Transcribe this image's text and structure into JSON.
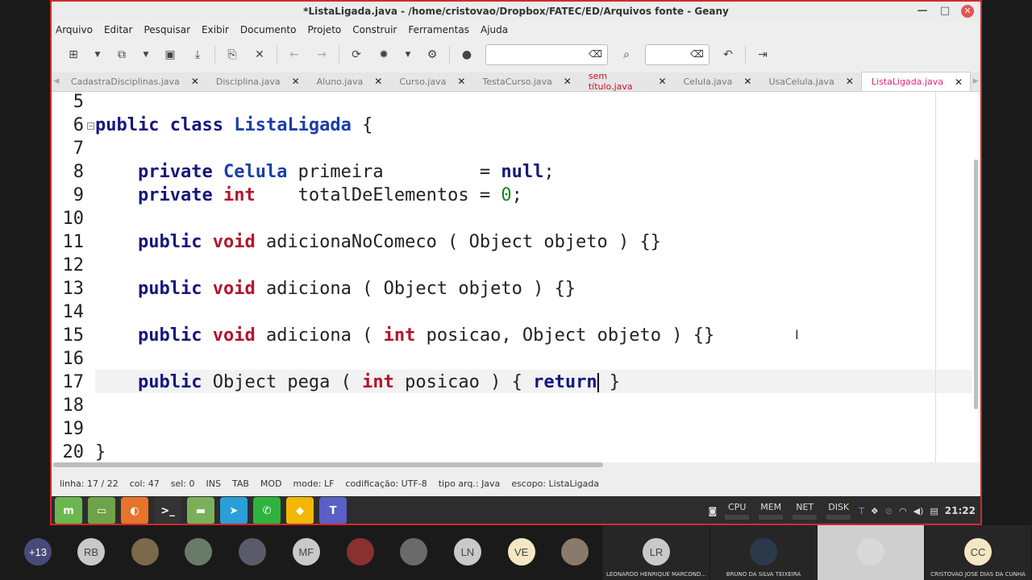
{
  "window": {
    "title": "*ListaLigada.java - /home/cristovao/Dropbox/FATEC/ED/Arquivos fonte - Geany"
  },
  "menu": [
    "Arquivo",
    "Editar",
    "Pesquisar",
    "Exibir",
    "Documento",
    "Projeto",
    "Construir",
    "Ferramentas",
    "Ajuda"
  ],
  "toolbar": {
    "icons": [
      "new-file-icon",
      "dropdown-icon",
      "open-file-icon",
      "dropdown-icon",
      "save-icon",
      "save-all-icon",
      "revert-icon",
      "close-file-icon",
      "back-icon",
      "forward-icon",
      "compile-icon",
      "build-icon",
      "dropdown-icon",
      "execute-icon",
      "color-picker-icon"
    ],
    "search_value": "",
    "goto_value": ""
  },
  "tabs": [
    {
      "label": "CadastraDisciplinas.java",
      "state": "normal"
    },
    {
      "label": "Disciplina.java",
      "state": "normal"
    },
    {
      "label": "Aluno.java",
      "state": "normal"
    },
    {
      "label": "Curso.java",
      "state": "normal"
    },
    {
      "label": "TestaCurso.java",
      "state": "normal"
    },
    {
      "label": "sem título.java",
      "state": "modified"
    },
    {
      "label": "Celula.java",
      "state": "normal"
    },
    {
      "label": "UsaCelula.java",
      "state": "normal"
    },
    {
      "label": "ListaLigada.java",
      "state": "active"
    }
  ],
  "editor": {
    "line_numbers": [
      "5",
      "6",
      "7",
      "8",
      "9",
      "10",
      "11",
      "12",
      "13",
      "14",
      "15",
      "16",
      "17",
      "18",
      "19",
      "20"
    ],
    "lines": [
      {
        "n": "6",
        "tokens": [
          {
            "t": "public",
            "c": "kw"
          },
          {
            "t": " "
          },
          {
            "t": "class",
            "c": "kw"
          },
          {
            "t": " "
          },
          {
            "t": "ListaLigada",
            "c": "cls"
          },
          {
            "t": " {"
          }
        ]
      },
      {
        "n": "8",
        "tokens": [
          {
            "t": "    "
          },
          {
            "t": "private",
            "c": "kw"
          },
          {
            "t": " "
          },
          {
            "t": "Celula",
            "c": "cls"
          },
          {
            "t": " primeira         = "
          },
          {
            "t": "null",
            "c": "kw"
          },
          {
            "t": ";"
          }
        ]
      },
      {
        "n": "9",
        "tokens": [
          {
            "t": "    "
          },
          {
            "t": "private",
            "c": "kw"
          },
          {
            "t": " "
          },
          {
            "t": "int",
            "c": "ty"
          },
          {
            "t": "    totalDeElementos = "
          },
          {
            "t": "0",
            "c": "num"
          },
          {
            "t": ";"
          }
        ]
      },
      {
        "n": "11",
        "tokens": [
          {
            "t": "    "
          },
          {
            "t": "public",
            "c": "kw"
          },
          {
            "t": " "
          },
          {
            "t": "void",
            "c": "ty"
          },
          {
            "t": " adicionaNoComeco ( Object objeto ) {}"
          }
        ]
      },
      {
        "n": "13",
        "tokens": [
          {
            "t": "    "
          },
          {
            "t": "public",
            "c": "kw"
          },
          {
            "t": " "
          },
          {
            "t": "void",
            "c": "ty"
          },
          {
            "t": " adiciona ( Object objeto ) {}"
          }
        ]
      },
      {
        "n": "15",
        "tokens": [
          {
            "t": "    "
          },
          {
            "t": "public",
            "c": "kw"
          },
          {
            "t": " "
          },
          {
            "t": "void",
            "c": "ty"
          },
          {
            "t": " adiciona ( "
          },
          {
            "t": "int",
            "c": "ty"
          },
          {
            "t": " posicao, Object objeto ) {}"
          }
        ]
      },
      {
        "n": "17",
        "tokens": [
          {
            "t": "    "
          },
          {
            "t": "public",
            "c": "kw"
          },
          {
            "t": " Object pega ( "
          },
          {
            "t": "int",
            "c": "ty"
          },
          {
            "t": " posicao ) { "
          },
          {
            "t": "return",
            "c": "kw"
          },
          {
            "t": "|CURSOR|"
          },
          {
            "t": " }"
          }
        ]
      },
      {
        "n": "20",
        "tokens": [
          {
            "t": "}"
          }
        ]
      }
    ]
  },
  "status": {
    "line": "linha: 17 / 22",
    "col": "col: 47",
    "sel": "sel: 0",
    "ins": "INS",
    "tab": "TAB",
    "mod": "MOD",
    "mode": "mode: LF",
    "encoding": "codificação: UTF-8",
    "filetype": "tipo arq.: Java",
    "scope": "escopo: ListaLigada"
  },
  "panel": {
    "apps": [
      {
        "name": "mint-menu-icon",
        "color": "#6bb64f",
        "glyph": "m"
      },
      {
        "name": "files-icon",
        "color": "#6ea34a",
        "glyph": "▭"
      },
      {
        "name": "firefox-icon",
        "color": "#e8732a",
        "glyph": "◐"
      },
      {
        "name": "terminal-icon",
        "color": "#333333",
        "glyph": ">_"
      },
      {
        "name": "folder-icon",
        "color": "#7ab05a",
        "glyph": "▬"
      },
      {
        "name": "telegram-icon",
        "color": "#2a9ed9",
        "glyph": "➤"
      },
      {
        "name": "whatsapp-icon",
        "color": "#2fb33f",
        "glyph": "✆"
      },
      {
        "name": "geany-icon",
        "color": "#f2b705",
        "glyph": "◆"
      },
      {
        "name": "teams-icon",
        "color": "#5a5fc7",
        "glyph": "T"
      }
    ],
    "monitors": [
      "CPU",
      "MEM",
      "NET",
      "DISK"
    ],
    "clock": "21:22"
  },
  "participants": {
    "count_label": "+13",
    "avatars": [
      {
        "initials": "RB",
        "color": "#c9c9c9"
      },
      {
        "initials": "",
        "color": "#7a6a4a"
      },
      {
        "initials": "",
        "color": "#6a7a6a"
      },
      {
        "initials": "",
        "color": "#5a5a6a"
      },
      {
        "initials": "MF",
        "color": "#c9c9c9"
      },
      {
        "initials": "",
        "color": "#8a3030"
      },
      {
        "initials": "",
        "color": "#6a6a6a"
      },
      {
        "initials": "LN",
        "color": "#c9c9c9"
      },
      {
        "initials": "VE",
        "color": "#f4e7c4"
      },
      {
        "initials": "",
        "color": "#8a7a6a"
      }
    ],
    "tiles": [
      {
        "name": "LEONARDO HENRIQUE MARCOND...",
        "initials": "LR",
        "color": "#c9c9c9"
      },
      {
        "name": "BRUNO DA SILVA TEIXEIRA",
        "initials": "",
        "color": "#2a3a4a"
      },
      {
        "name": "",
        "initials": "",
        "color": "#d9d9d9"
      },
      {
        "name": "CRISTOVAO JOSE DIAS DA CUNHA",
        "initials": "CC",
        "color": "#f4e7c4"
      }
    ]
  }
}
